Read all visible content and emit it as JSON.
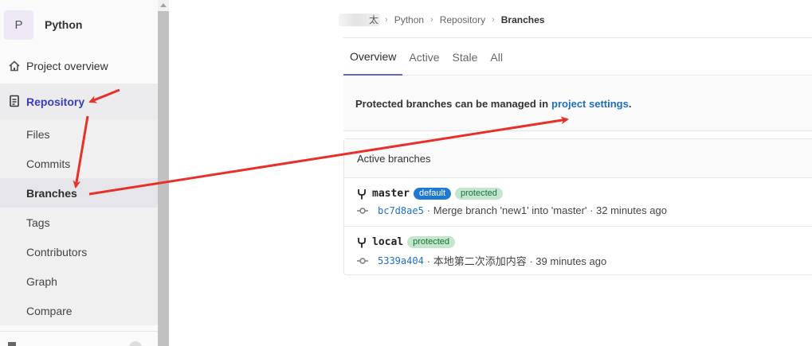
{
  "project": {
    "avatar_letter": "P",
    "name": "Python"
  },
  "sidebar": {
    "overview_label": "Project overview",
    "repository_label": "Repository",
    "sub_items": [
      "Files",
      "Commits",
      "Branches",
      "Tags",
      "Contributors",
      "Graph",
      "Compare"
    ],
    "active_sub": "Branches"
  },
  "breadcrumb": {
    "owner_visible": "太",
    "project": "Python",
    "section": "Repository",
    "current": "Branches"
  },
  "tabs": [
    {
      "label": "Overview",
      "active": true
    },
    {
      "label": "Active",
      "active": false
    },
    {
      "label": "Stale",
      "active": false
    },
    {
      "label": "All",
      "active": false
    }
  ],
  "notice": {
    "text": "Protected branches can be managed in",
    "link": "project settings",
    "tail": "."
  },
  "panel": {
    "title": "Active branches",
    "branches": [
      {
        "name": "master",
        "badges": [
          "default",
          "protected"
        ],
        "sha": "bc7d8ae5",
        "message": "· Merge branch 'new1' into 'master' · 32 minutes ago"
      },
      {
        "name": "local",
        "badges": [
          "protected"
        ],
        "sha": "5339a404",
        "message": "· 本地第二次添加内容 · 39 minutes ago"
      }
    ]
  },
  "colors": {
    "link": "#1f6fbf",
    "annotation_arrow": "#e8302a",
    "default_badge": "#1f78d1",
    "protected_badge": "#c3e6cd"
  },
  "icons": [
    "home-icon",
    "doc-icon",
    "fork-icon",
    "commit-icon"
  ]
}
